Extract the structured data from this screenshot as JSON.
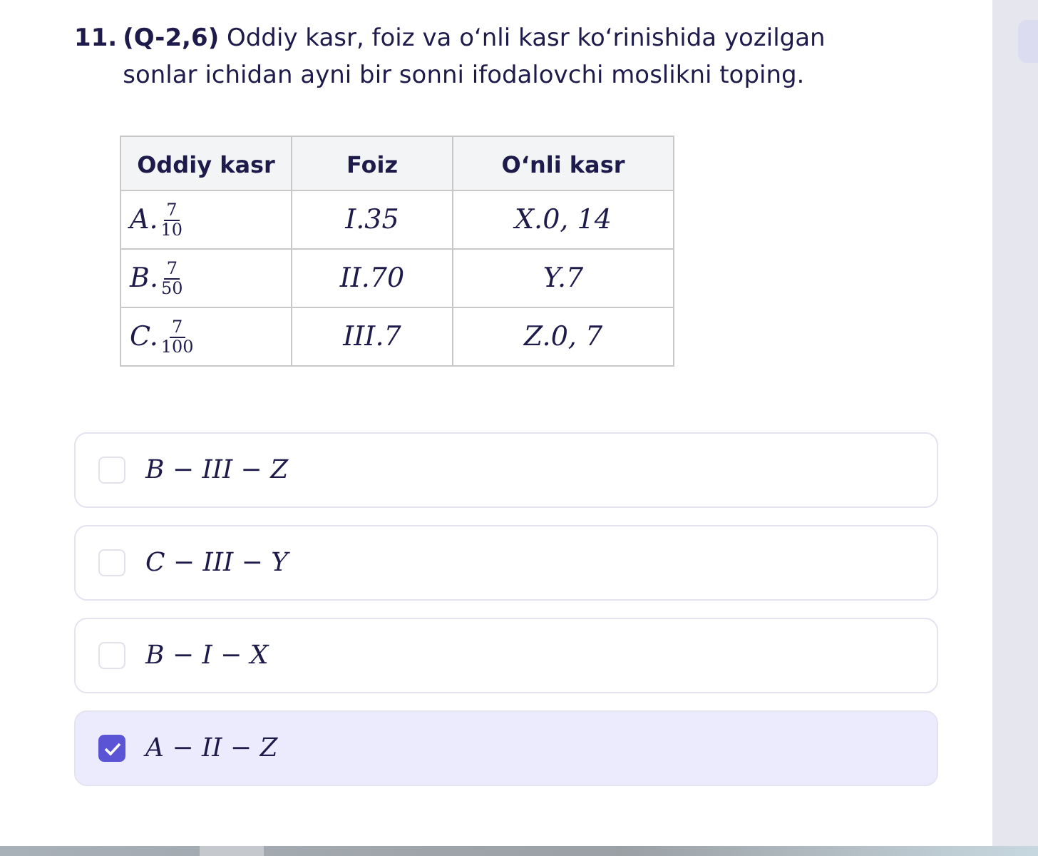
{
  "question": {
    "number": "11.",
    "text": "**(Q-2,6)** Oddiy kasr, foiz va oʻnli kasr koʻrinishida yozilgan sonlar ichidan ayni bir sonni ifodalovchi moslikni toping."
  },
  "table": {
    "columns": [
      "Oddiy kasr",
      "Foiz",
      "Oʻnli kasr"
    ],
    "rows": [
      [
        {
          "kind": "fraction",
          "prefix": "A.",
          "numerator": "7",
          "denominator": "10"
        },
        {
          "kind": "text",
          "text": "I.35"
        },
        {
          "kind": "text",
          "text": "X.0, 14"
        }
      ],
      [
        {
          "kind": "fraction",
          "prefix": "B.",
          "numerator": "7",
          "denominator": "50"
        },
        {
          "kind": "text",
          "text": "II.70"
        },
        {
          "kind": "text",
          "text": "Y.7"
        }
      ],
      [
        {
          "kind": "fraction",
          "prefix": "C.",
          "numerator": "7",
          "denominator": "100"
        },
        {
          "kind": "text",
          "text": "III.7"
        },
        {
          "kind": "text",
          "text": "Z.0, 7"
        }
      ]
    ]
  },
  "options": [
    {
      "label": "B − III − Z",
      "checked": false
    },
    {
      "label": "C − III − Y",
      "checked": false
    },
    {
      "label": "B − I − X",
      "checked": false
    },
    {
      "label": "A − II − Z",
      "checked": true
    }
  ]
}
